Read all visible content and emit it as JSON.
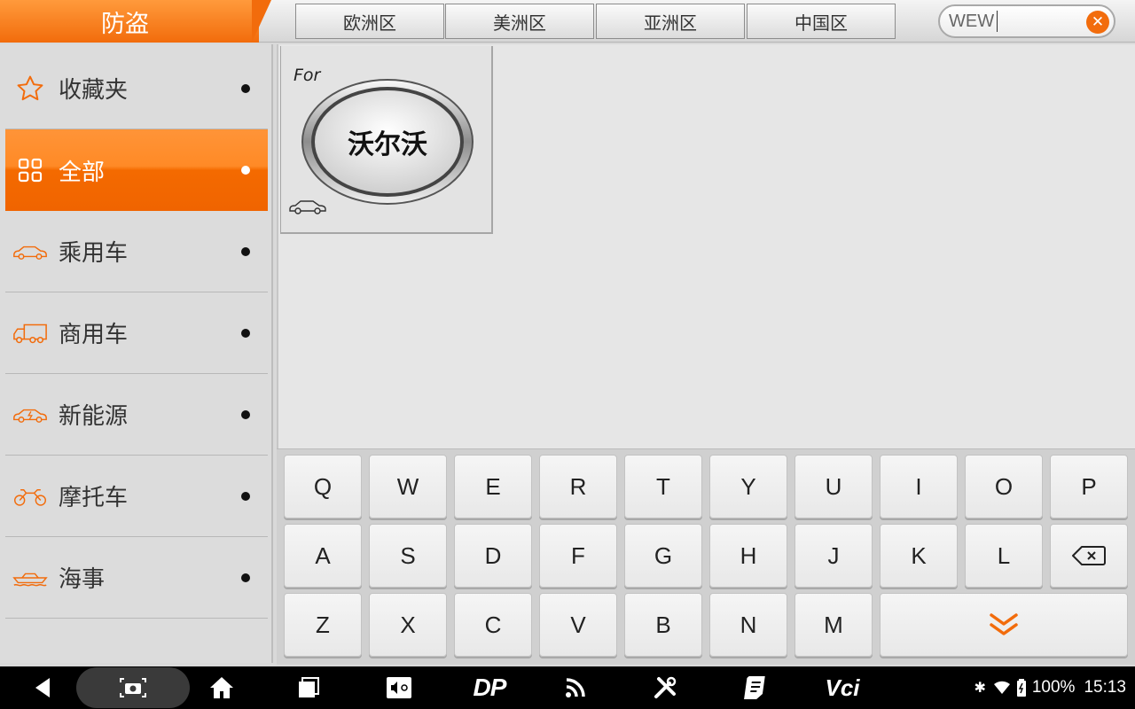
{
  "header": {
    "title": "防盗",
    "regions": [
      "欧洲区",
      "美洲区",
      "亚洲区",
      "中国区"
    ],
    "search": {
      "value": "WEW",
      "clear_glyph": "✕"
    }
  },
  "sidebar": {
    "items": [
      {
        "label": "收藏夹",
        "icon": "star-icon",
        "active": false
      },
      {
        "label": "全部",
        "icon": "grid-icon",
        "active": true
      },
      {
        "label": "乘用车",
        "icon": "passenger-car-icon",
        "active": false
      },
      {
        "label": "商用车",
        "icon": "truck-icon",
        "active": false
      },
      {
        "label": "新能源",
        "icon": "ev-car-icon",
        "active": false
      },
      {
        "label": "摩托车",
        "icon": "motorcycle-icon",
        "active": false
      },
      {
        "label": "海事",
        "icon": "boat-icon",
        "active": false
      }
    ]
  },
  "content": {
    "brands": [
      {
        "prefix": "For",
        "name": "沃尔沃",
        "type_icon": "car-outline-icon"
      }
    ]
  },
  "keyboard": {
    "rows": [
      [
        "Q",
        "W",
        "E",
        "R",
        "T",
        "Y",
        "U",
        "I",
        "O",
        "P"
      ],
      [
        "A",
        "S",
        "D",
        "F",
        "G",
        "H",
        "J",
        "K",
        "L"
      ],
      [
        "Z",
        "X",
        "C",
        "V",
        "B",
        "N",
        "M"
      ]
    ],
    "special_keys": [
      "backspace-icon",
      "hide-keyboard-icon"
    ]
  },
  "system_bar": {
    "buttons": [
      "back-icon",
      "screenshot-icon",
      "home-icon",
      "recents-icon",
      "volume-brightness-icon",
      "dp-icon",
      "wifi-signal-icon",
      "tools-icon",
      "notes-icon",
      "vci-icon"
    ],
    "dp_label": "DP",
    "vci_label": "Vci",
    "battery": "100%",
    "time": "15:13"
  },
  "colors": {
    "accent": "#f26c0c",
    "sidebar_bg": "#dcdcdc",
    "content_bg": "#e6e6e6"
  }
}
